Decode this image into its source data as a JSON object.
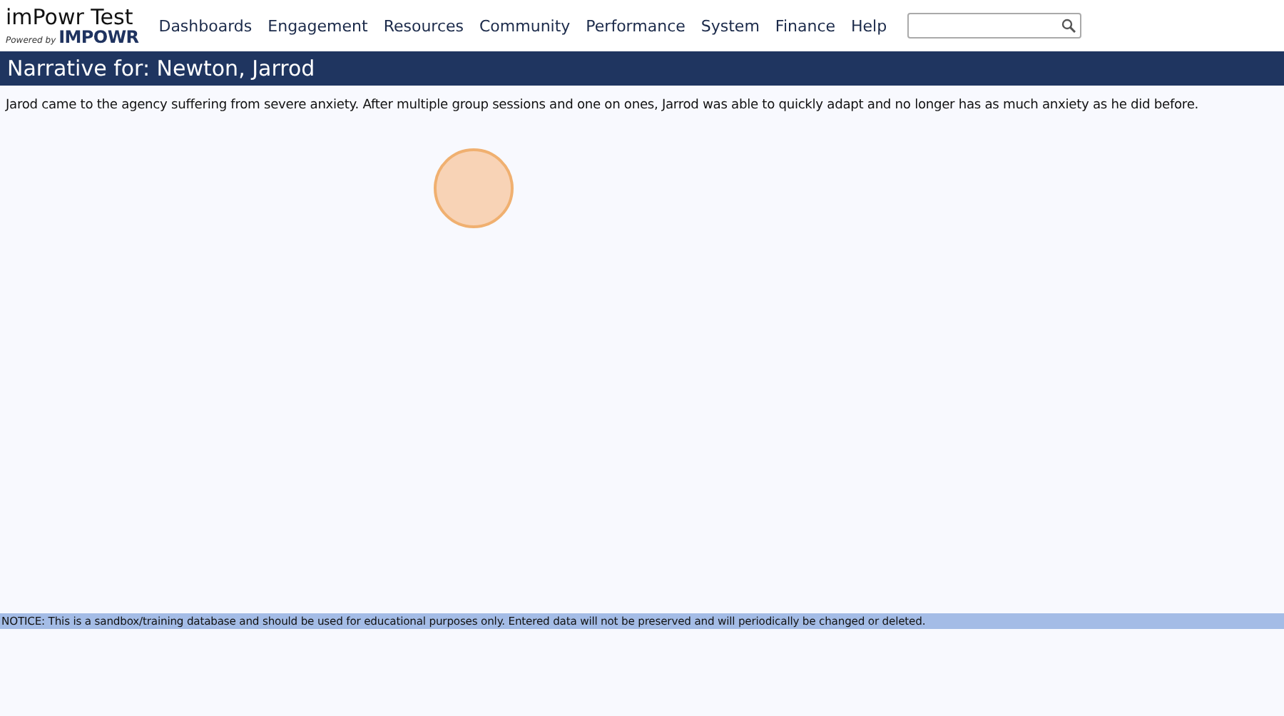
{
  "header": {
    "app_title": "imPowr Test",
    "powered_by": "Powered by",
    "brand": "IMPOWR"
  },
  "nav": [
    "Dashboards",
    "Engagement",
    "Resources",
    "Community",
    "Performance",
    "System",
    "Finance",
    "Help"
  ],
  "title_bar": {
    "title": "Narrative for: Newton, Jarrod"
  },
  "narrative": "Jarod came to the agency suffering from severe anxiety. After multiple group sessions and one on ones, Jarrod was able to quickly adapt and no longer has as much anxiety as he did before.",
  "notice": "NOTICE: This is a sandbox/training database and should be used for educational purposes only. Entered data will not be preserved and will periodically be changed or deleted."
}
